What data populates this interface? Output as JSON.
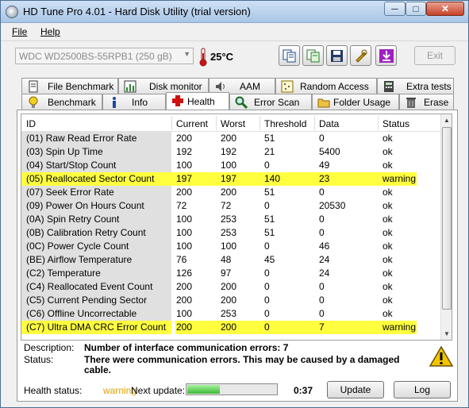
{
  "window": {
    "title": "HD Tune Pro 4.01 - Hard Disk Utility (trial version)",
    "min": "─",
    "max": "□",
    "close": "✕"
  },
  "menu": {
    "file": "File",
    "help": "Help"
  },
  "drive": {
    "selected": "WDC WD2500BS-55RPB1 (250 gB)",
    "temperature": "25°C",
    "exit_label": "Exit"
  },
  "tabs_top": [
    {
      "label": "File Benchmark",
      "icon": "document-icon"
    },
    {
      "label": "Disk monitor",
      "icon": "chart-icon"
    },
    {
      "label": "AAM",
      "icon": "speaker-icon"
    },
    {
      "label": "Random Access",
      "icon": "grid-icon"
    },
    {
      "label": "Extra tests",
      "icon": "calculator-icon"
    }
  ],
  "tabs_bottom": [
    {
      "label": "Benchmark",
      "icon": "bulb-icon"
    },
    {
      "label": "Info",
      "icon": "info-icon"
    },
    {
      "label": "Health",
      "icon": "cross-icon",
      "active": true
    },
    {
      "label": "Error Scan",
      "icon": "magnifier-icon"
    },
    {
      "label": "Folder Usage",
      "icon": "folder-icon"
    },
    {
      "label": "Erase",
      "icon": "trash-icon"
    }
  ],
  "table": {
    "columns": [
      "ID",
      "Current",
      "Worst",
      "Threshold",
      "Data",
      "Status"
    ],
    "rows": [
      {
        "id": "(01) Raw Read Error Rate",
        "current": "200",
        "worst": "200",
        "threshold": "51",
        "data": "0",
        "status": "ok"
      },
      {
        "id": "(03) Spin Up Time",
        "current": "192",
        "worst": "192",
        "threshold": "21",
        "data": "5400",
        "status": "ok"
      },
      {
        "id": "(04) Start/Stop Count",
        "current": "100",
        "worst": "100",
        "threshold": "0",
        "data": "49",
        "status": "ok"
      },
      {
        "id": "(05) Reallocated Sector Count",
        "current": "197",
        "worst": "197",
        "threshold": "140",
        "data": "23",
        "status": "warning",
        "warn": true
      },
      {
        "id": "(07) Seek Error Rate",
        "current": "200",
        "worst": "200",
        "threshold": "51",
        "data": "0",
        "status": "ok"
      },
      {
        "id": "(09) Power On Hours Count",
        "current": "72",
        "worst": "72",
        "threshold": "0",
        "data": "20530",
        "status": "ok"
      },
      {
        "id": "(0A) Spin Retry Count",
        "current": "100",
        "worst": "253",
        "threshold": "51",
        "data": "0",
        "status": "ok"
      },
      {
        "id": "(0B) Calibration Retry Count",
        "current": "100",
        "worst": "253",
        "threshold": "51",
        "data": "0",
        "status": "ok"
      },
      {
        "id": "(0C) Power Cycle Count",
        "current": "100",
        "worst": "100",
        "threshold": "0",
        "data": "46",
        "status": "ok"
      },
      {
        "id": "(BE) Airflow Temperature",
        "current": "76",
        "worst": "48",
        "threshold": "45",
        "data": "24",
        "status": "ok"
      },
      {
        "id": "(C2) Temperature",
        "current": "126",
        "worst": "97",
        "threshold": "0",
        "data": "24",
        "status": "ok"
      },
      {
        "id": "(C4) Reallocated Event Count",
        "current": "200",
        "worst": "200",
        "threshold": "0",
        "data": "0",
        "status": "ok"
      },
      {
        "id": "(C5) Current Pending Sector",
        "current": "200",
        "worst": "200",
        "threshold": "0",
        "data": "0",
        "status": "ok"
      },
      {
        "id": "(C6) Offline Uncorrectable",
        "current": "100",
        "worst": "253",
        "threshold": "0",
        "data": "0",
        "status": "ok"
      },
      {
        "id": "(C7) Ultra DMA CRC Error Count",
        "current": "200",
        "worst": "200",
        "threshold": "0",
        "data": "7",
        "status": "warning",
        "warn": true
      }
    ]
  },
  "details": {
    "description_label": "Description:",
    "description": "Number of interface communication errors: 7",
    "status_label": "Status:",
    "status_line1": "There were communication errors. This may be caused by a damaged",
    "status_line2": "cable."
  },
  "footer": {
    "health_label": "Health status:",
    "health_value": "warning",
    "next_update_label": "Next update:",
    "progress_fraction": 0.37,
    "timer": "0:37",
    "update_button": "Update",
    "log_button": "Log"
  },
  "colors": {
    "warning_row": "#ffff40",
    "health_warning_text": "#e0a000",
    "progress_fill": "#3dbb34"
  }
}
